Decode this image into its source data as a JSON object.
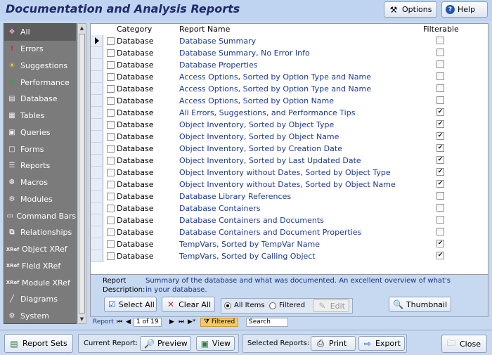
{
  "header": {
    "title": "Documentation and Analysis Reports",
    "options_label": "Options",
    "help_label": "Help"
  },
  "sidebar": {
    "items": [
      {
        "label": "All",
        "icon": "all-icon",
        "selected": true
      },
      {
        "label": "Errors",
        "icon": "exclamation-icon"
      },
      {
        "label": "Suggestions",
        "icon": "lightbulb-icon"
      },
      {
        "label": "Performance",
        "icon": "question-icon"
      },
      {
        "label": "Database",
        "icon": "database-icon"
      },
      {
        "label": "Tables",
        "icon": "table-icon"
      },
      {
        "label": "Queries",
        "icon": "query-icon"
      },
      {
        "label": "Forms",
        "icon": "form-icon"
      },
      {
        "label": "Reports",
        "icon": "report-icon"
      },
      {
        "label": "Macros",
        "icon": "macro-icon"
      },
      {
        "label": "Modules",
        "icon": "module-icon"
      },
      {
        "label": "Command Bars",
        "icon": "command-bar-icon"
      },
      {
        "label": "Relationships",
        "icon": "relationship-icon"
      },
      {
        "label": "Object XRef",
        "icon": "xref-icon"
      },
      {
        "label": "FIeld XRef",
        "icon": "xref-icon"
      },
      {
        "label": "Module XRef",
        "icon": "xref-icon"
      },
      {
        "label": "Diagrams",
        "icon": "diagram-icon"
      },
      {
        "label": "System",
        "icon": "system-icon"
      }
    ]
  },
  "list": {
    "headers": {
      "category": "Category",
      "report_name": "Report Name",
      "filterable": "Filterable"
    },
    "rows": [
      {
        "category": "Database",
        "name": "Database Summary",
        "filterable": false,
        "current": true
      },
      {
        "category": "Database",
        "name": "Database Summary, No Error Info",
        "filterable": false
      },
      {
        "category": "Database",
        "name": "Database Properties",
        "filterable": false
      },
      {
        "category": "Database",
        "name": "Access Options, Sorted by Option Type and Name",
        "filterable": false
      },
      {
        "category": "Database",
        "name": "Access Options, Sorted by Option Type and Name",
        "filterable": false
      },
      {
        "category": "Database",
        "name": "Access Options, Sorted by Option Name",
        "filterable": false
      },
      {
        "category": "Database",
        "name": "All Errors, Suggestions, and Performance Tips",
        "filterable": true
      },
      {
        "category": "Database",
        "name": "Object Inventory, Sorted by Object Type",
        "filterable": true
      },
      {
        "category": "Database",
        "name": "Object Inventory, Sorted by Object Name",
        "filterable": true
      },
      {
        "category": "Database",
        "name": "Object Inventory, Sorted by Creation Date",
        "filterable": true
      },
      {
        "category": "Database",
        "name": "Object Inventory, Sorted by Last Updated Date",
        "filterable": true
      },
      {
        "category": "Database",
        "name": "Object Inventory without Dates, Sorted by Object Type",
        "filterable": true
      },
      {
        "category": "Database",
        "name": "Object Inventory without Dates, Sorted by Object Name",
        "filterable": true
      },
      {
        "category": "Database",
        "name": "Database Library References",
        "filterable": false
      },
      {
        "category": "Database",
        "name": "Database Containers",
        "filterable": false
      },
      {
        "category": "Database",
        "name": "Database Containers and Documents",
        "filterable": false
      },
      {
        "category": "Database",
        "name": "Database Containers and Document Properties",
        "filterable": false
      },
      {
        "category": "Database",
        "name": "TempVars, Sorted by TempVar Name",
        "filterable": true
      },
      {
        "category": "Database",
        "name": "TempVars, Sorted by Calling Object",
        "filterable": true
      }
    ]
  },
  "detail": {
    "description_label": "Report\nDescription:",
    "description": "Summary of the database and what was documented. An excellent overview of what's in your database.",
    "select_all": "Select All",
    "clear_all": "Clear All",
    "radio_all": "All Items",
    "radio_filtered": "Filtered",
    "radio_selected": "all",
    "edit": "Edit",
    "thumbnail": "Thumbnail"
  },
  "navigation": {
    "record_label": "Report",
    "record_position": "1 of 19",
    "filter_state": "Filtered",
    "search": "Search"
  },
  "footer": {
    "report_sets": "Report Sets",
    "current_report_label": "Current Report:",
    "preview": "Preview",
    "view": "View",
    "selected_reports_label": "Selected Reports:",
    "print": "Print",
    "export": "Export",
    "close": "Close"
  },
  "colors": {
    "background": "#c6d9f1",
    "title": "#1f2a6a",
    "sidebar": "#7b7b7b",
    "link_text": "#1b3a8f",
    "filter_badge": "#f6c96b"
  }
}
